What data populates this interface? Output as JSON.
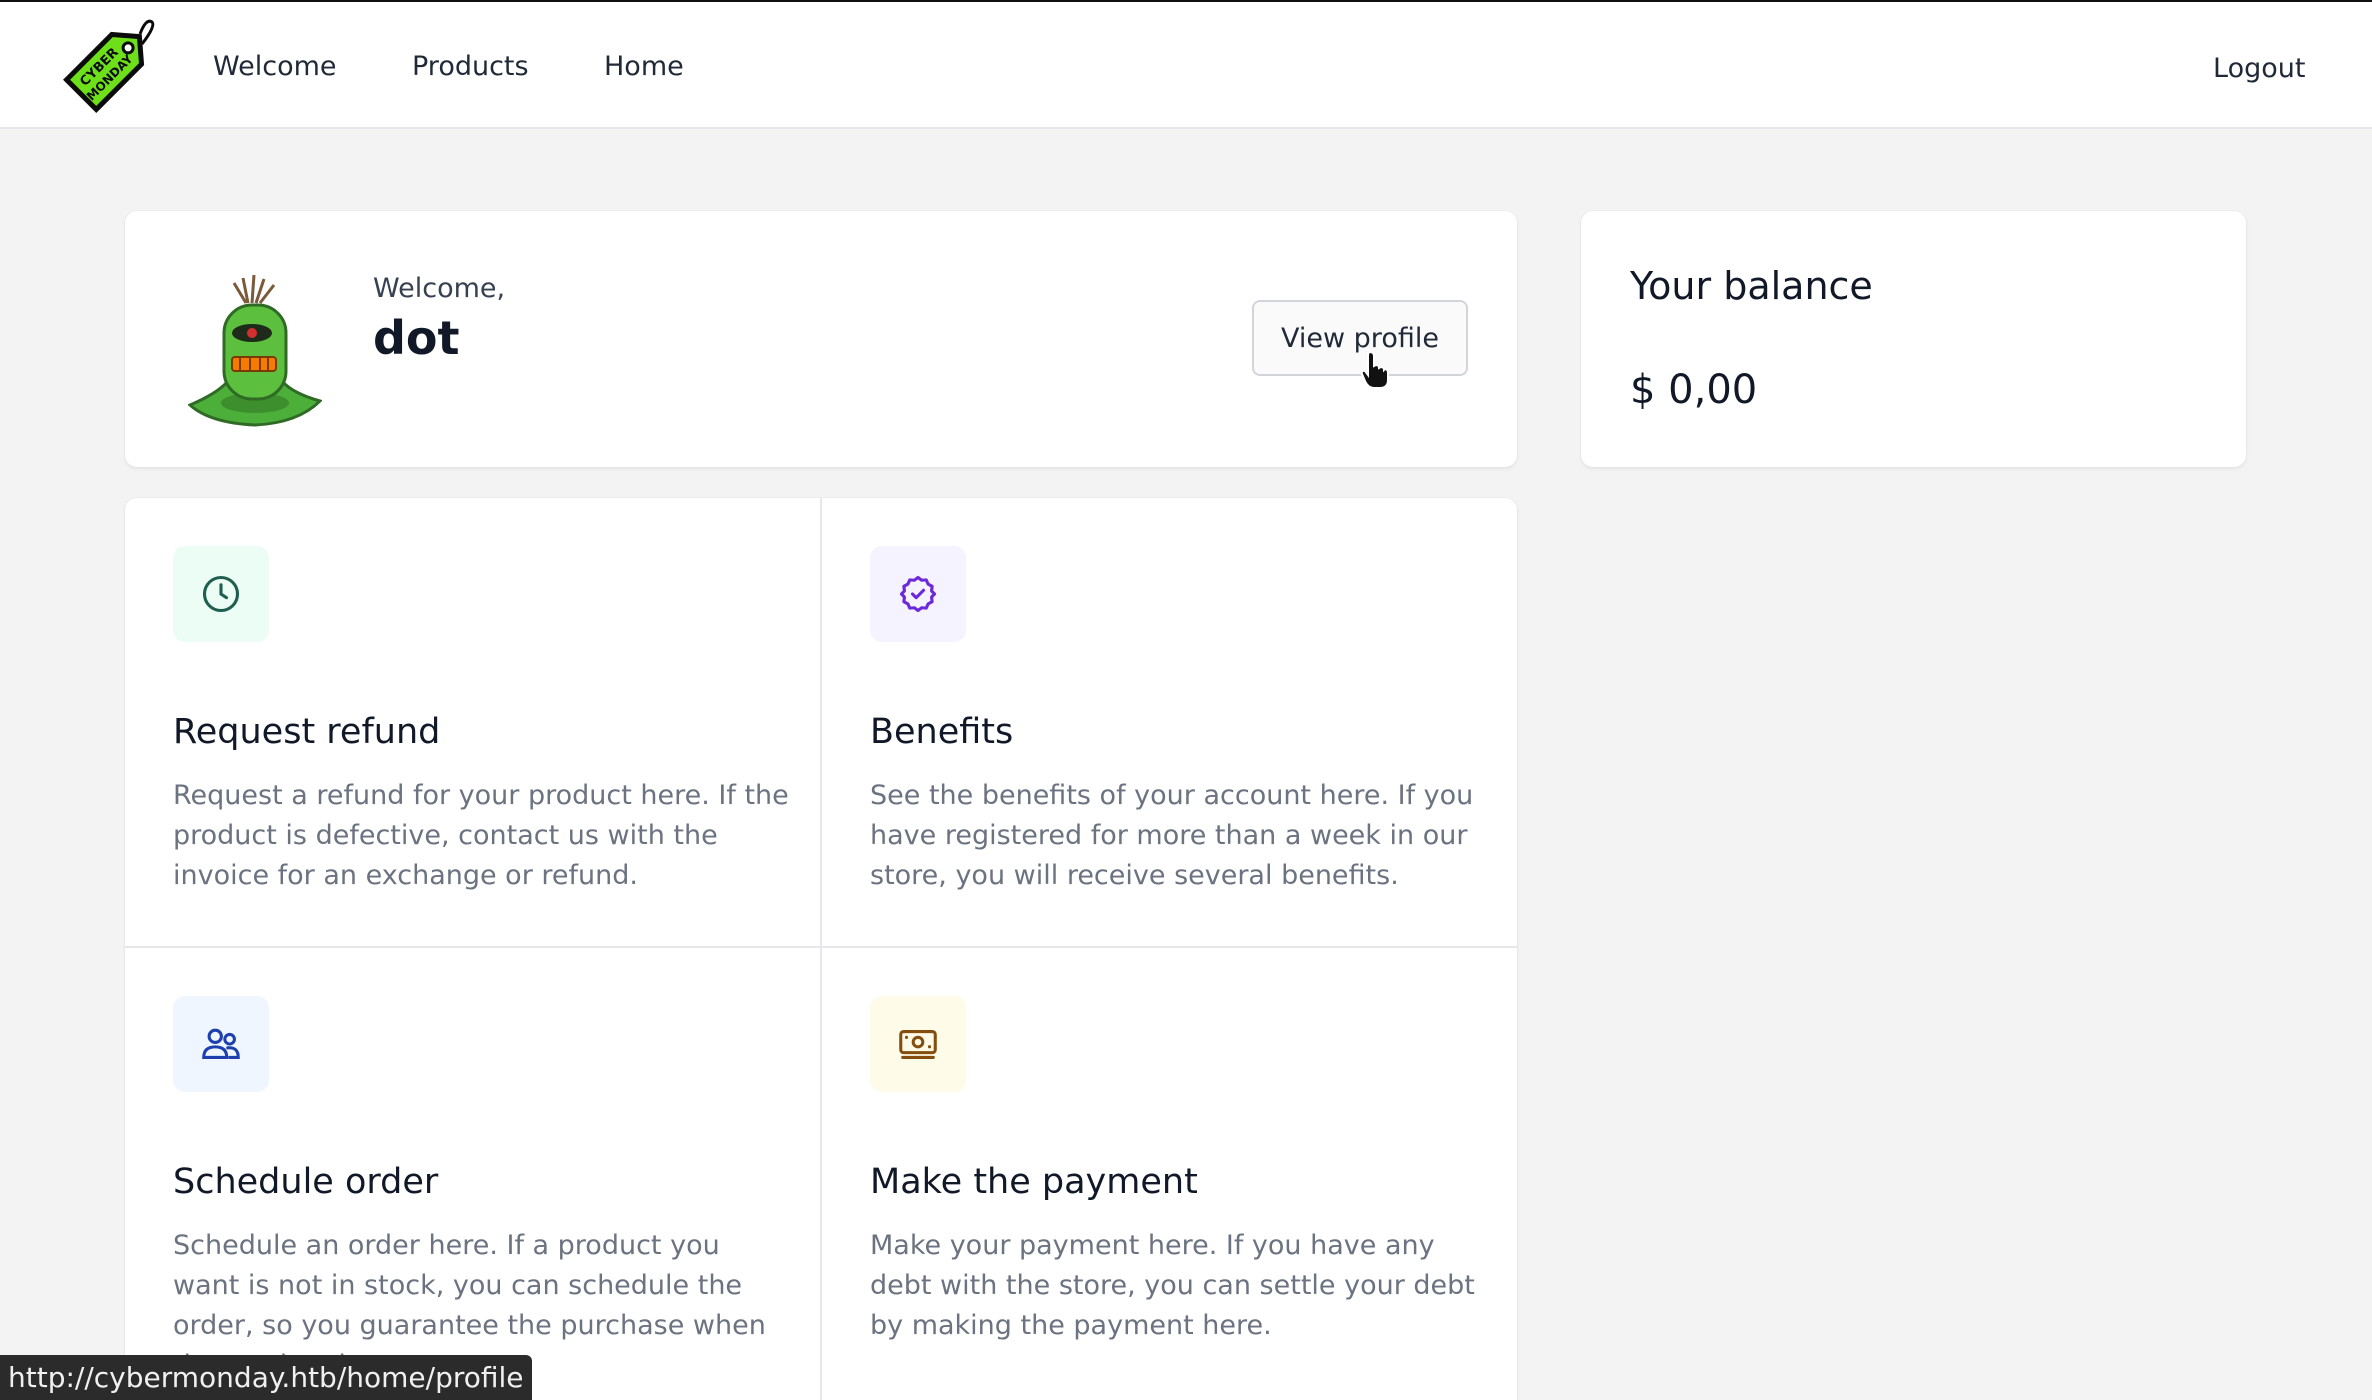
{
  "nav": {
    "logo_text": "CYBER MONDAY",
    "links": [
      "Welcome",
      "Products",
      "Home"
    ],
    "logout": "Logout"
  },
  "welcome": {
    "greeting": "Welcome,",
    "username": "dot",
    "view_profile": "View profile"
  },
  "balance": {
    "title": "Your balance",
    "amount": "$ 0,00"
  },
  "tiles": [
    {
      "icon": "clock-icon",
      "title": "Request refund",
      "description": "Request a refund for your product here. If the product is defective, contact us with the invoice for an exchange or refund.",
      "icon_bg": "#ecfdf5",
      "icon_color": "#1f5f4f"
    },
    {
      "icon": "badge-check-icon",
      "title": "Benefits",
      "description": "See the benefits of your account here. If you have registered for more than a week in our store, you will receive several benefits.",
      "icon_bg": "#f5f3ff",
      "icon_color": "#6d28d9"
    },
    {
      "icon": "users-icon",
      "title": "Schedule order",
      "description": "Schedule an order here. If a product you want is not in stock, you can schedule the order, so you guarantee the purchase when the product is",
      "icon_bg": "#eff6ff",
      "icon_color": "#1e40af"
    },
    {
      "icon": "banknote-icon",
      "title": "Make the payment",
      "description": "Make your payment here. If you have any debt with the store, you can settle your debt by making the payment here.",
      "icon_bg": "#fefce8",
      "icon_color": "#854d0e"
    }
  ],
  "status_url": "http://cybermonday.htb/home/profile"
}
